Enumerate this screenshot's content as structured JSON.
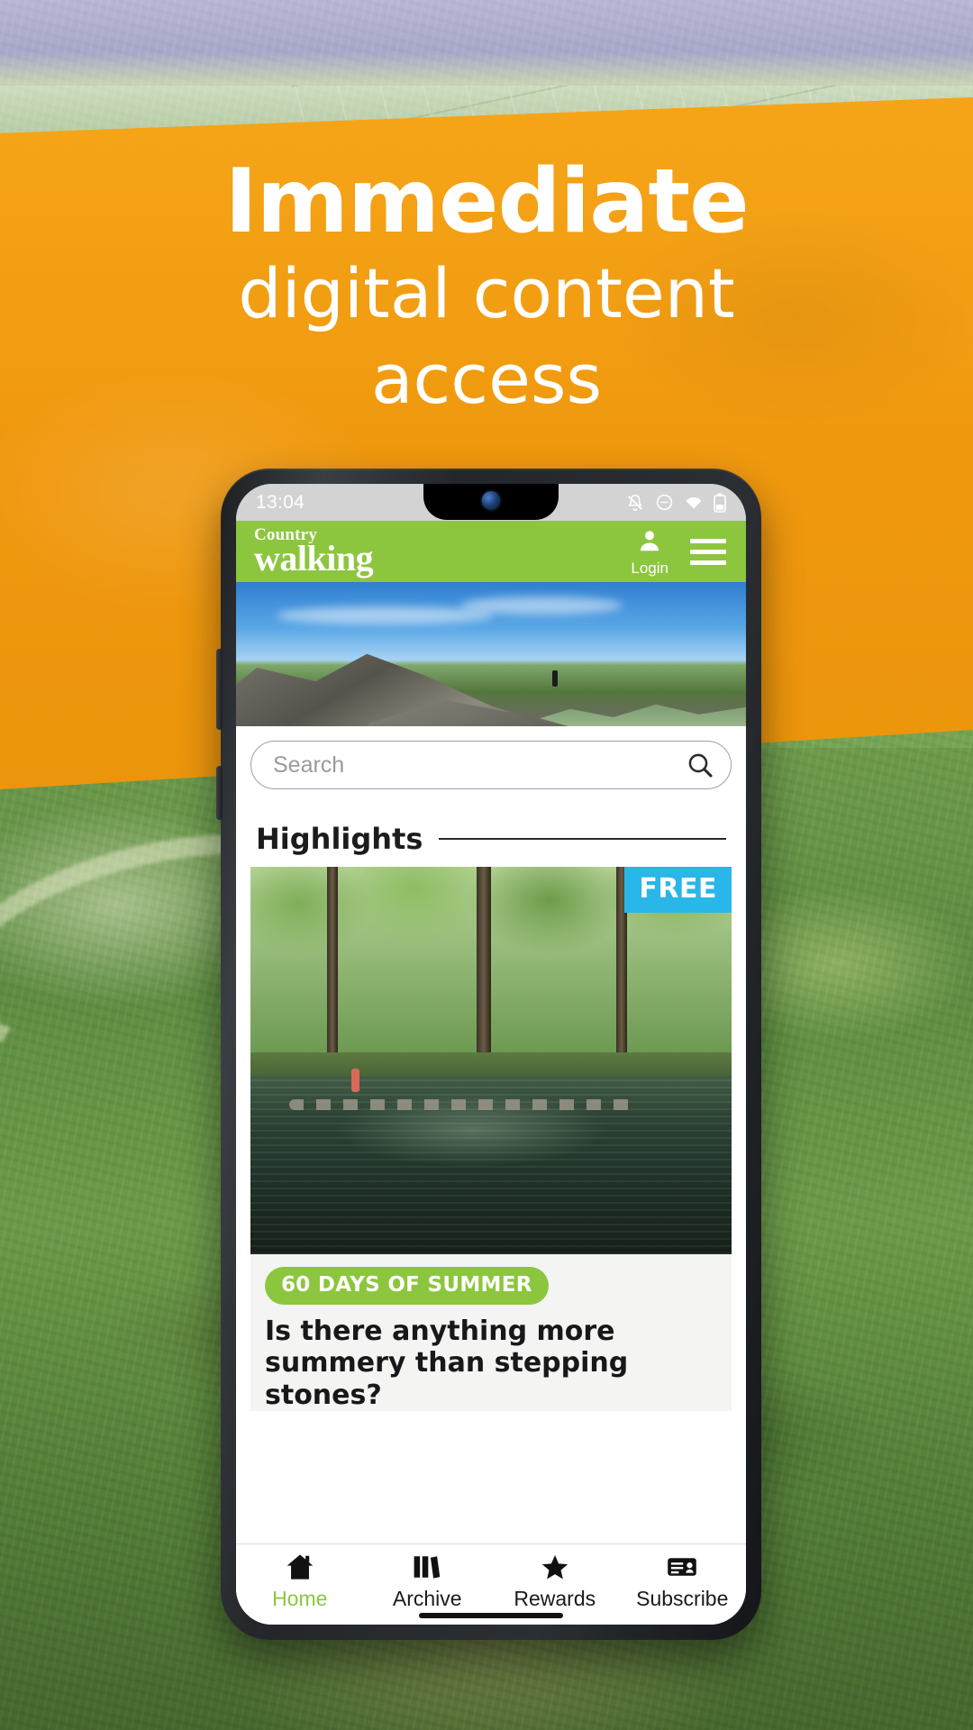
{
  "promo": {
    "headline_line1": "Immediate",
    "headline_line2": "digital content",
    "headline_line3": "access",
    "banner_color": "#f39c12"
  },
  "phone": {
    "status_bar": {
      "time": "13:04",
      "icons": [
        "bell-off-icon",
        "do-not-disturb-icon",
        "wifi-icon",
        "battery-icon"
      ]
    },
    "app": {
      "brand_color": "#8cc63e",
      "logo_line1": "Country",
      "logo_line2": "walking",
      "login_label": "Login",
      "menu_icon": "hamburger-menu-icon",
      "account_icon": "user-account-icon",
      "search": {
        "placeholder": "Search",
        "value": "",
        "icon": "search-icon"
      },
      "section": {
        "title": "Highlights"
      },
      "highlight_card": {
        "badge": "FREE",
        "badge_color": "#29b6e8",
        "tag": "60 DAYS OF SUMMER",
        "tag_color": "#8cc63e",
        "title": "Is there anything more summery than stepping stones?"
      },
      "bottom_nav": [
        {
          "label": "Home",
          "icon": "home-icon",
          "active": true
        },
        {
          "label": "Archive",
          "icon": "books-icon",
          "active": false
        },
        {
          "label": "Rewards",
          "icon": "star-icon",
          "active": false
        },
        {
          "label": "Subscribe",
          "icon": "id-card-icon",
          "active": false
        }
      ]
    }
  }
}
